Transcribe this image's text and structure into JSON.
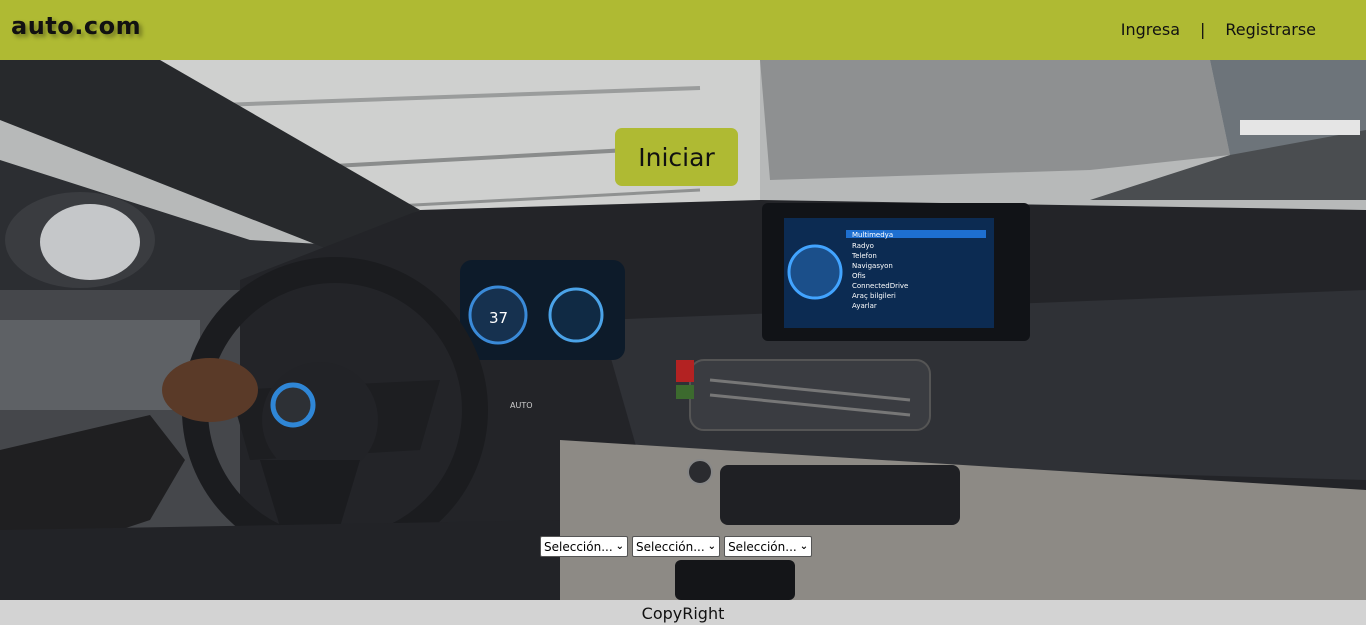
{
  "header": {
    "logo": "auto.com",
    "nav": {
      "login": "Ingresa",
      "separator": "|",
      "register": "Registrarse"
    }
  },
  "hero": {
    "image": "car-interior-image",
    "start_button": "Iniciar",
    "dashboard_readouts": {
      "speed": "37",
      "drive_mode": "AUTO"
    },
    "infotainment_menu": [
      "Multimedya",
      "Radyo",
      "Telefon",
      "Navigasyon",
      "Ofis",
      "ConnectedDrive",
      "Araç bilgileri",
      "Ayarlar"
    ],
    "selects": [
      {
        "value": "Selección..."
      },
      {
        "value": "Selección..."
      },
      {
        "value": "Selección..."
      }
    ]
  },
  "footer": {
    "text": "CopyRight"
  },
  "colors": {
    "accent": "#afba33",
    "footer_bg": "#d3d3d3"
  }
}
